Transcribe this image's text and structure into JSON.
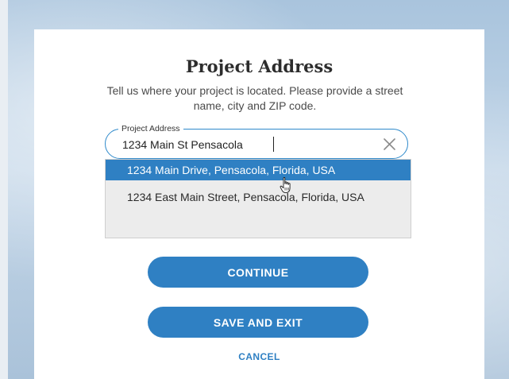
{
  "dialog": {
    "title": "Project Address",
    "description": "Tell us where your project is located. Please provide a street name, city and ZIP code."
  },
  "address_field": {
    "label": "Project Address",
    "value": "1234 Main St Pensacola",
    "clear_icon": "close-icon"
  },
  "suggestions": [
    {
      "label": "1234 Main Drive, Pensacola, Florida, USA",
      "highlighted": true
    },
    {
      "label": "1234 East Main Street, Pensacola, Florida, USA",
      "highlighted": false
    }
  ],
  "actions": {
    "continue_label": "CONTINUE",
    "save_exit_label": "SAVE AND EXIT",
    "cancel_label": "CANCEL"
  },
  "colors": {
    "accent": "#2f80c3",
    "field_border": "#2f8acb",
    "dropdown_bg": "#ececec",
    "title_text": "#2d2d2d"
  },
  "pointer": "hand-cursor-icon"
}
